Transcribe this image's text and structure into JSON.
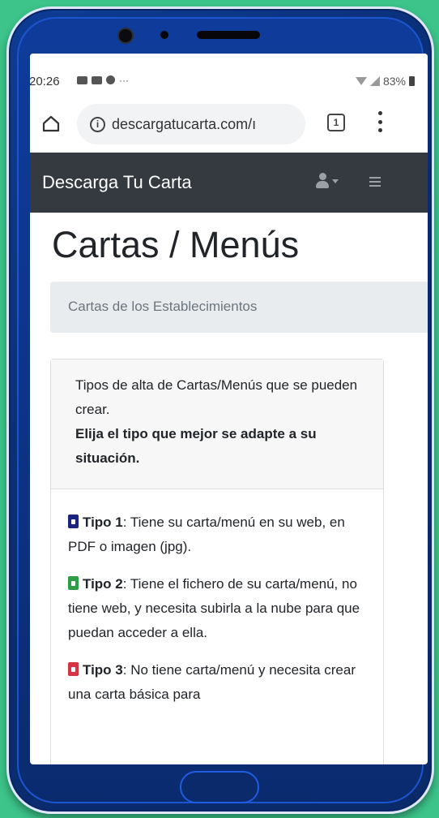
{
  "status": {
    "time": "20:26",
    "battery": "83%"
  },
  "browser": {
    "url": "descargatucarta.com/ı",
    "tab_count": "1"
  },
  "navbar": {
    "brand": "Descarga Tu Carta"
  },
  "page": {
    "title": "Cartas / Menús",
    "breadcrumb": "Cartas de los Establecimientos"
  },
  "card": {
    "header_text": "Tipos de alta de Cartas/Menús que se pueden crear.",
    "header_bold": "Elija el tipo que mejor se adapte a su situación.",
    "tipos": [
      {
        "label": "Tipo 1",
        "text": ": Tiene su carta/menú en su web, en PDF o imagen (jpg).",
        "color": "#1a237e"
      },
      {
        "label": "Tipo 2",
        "text": ": Tiene el fichero de su carta/menú, no tiene web, y necesita subirla a la nube para que puedan acceder a ella.",
        "color": "#2e9e46"
      },
      {
        "label": "Tipo 3",
        "text": ": No tiene carta/menú y necesita crear una carta básica para",
        "color": "#d63343"
      }
    ]
  },
  "colors": {
    "background": "#3cc48a",
    "navbar": "#343a40",
    "phone_body": "#0e3c94"
  }
}
